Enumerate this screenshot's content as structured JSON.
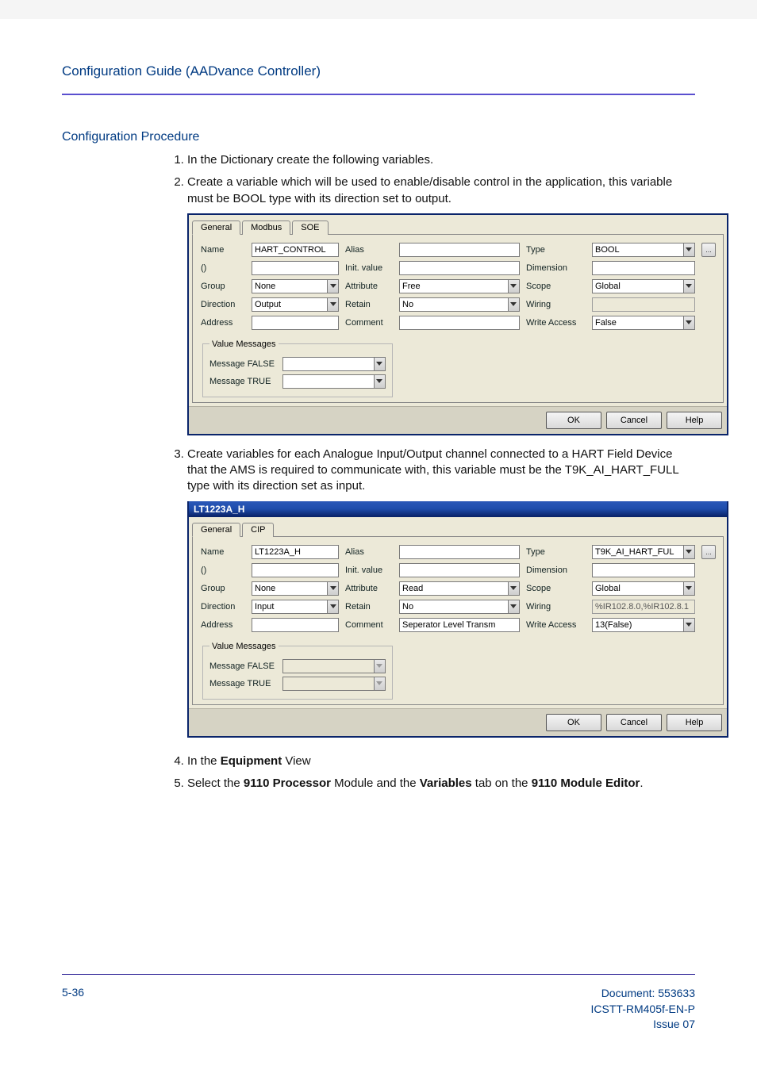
{
  "header": {
    "title": "Configuration Guide (AADvance Controller)"
  },
  "section": {
    "title": "Configuration Procedure"
  },
  "steps": {
    "s1": "In the Dictionary create the following variables.",
    "s2": "Create a variable which will be used to enable/disable control in the application, this variable must be BOOL type with its direction set to output.",
    "s3": "Create variables for each Analogue Input/Output channel connected to a HART Field Device that the AMS is required to communicate with, this variable must be the T9K_AI_HART_FULL type with its direction set as input.",
    "s4_prefix": "In the ",
    "s4_bold": "Equipment",
    "s4_suffix": " View",
    "s5_p1": "Select the ",
    "s5_b1": "9110 Processor",
    "s5_p2": " Module and the ",
    "s5_b2": "Variables",
    "s5_p3": " tab on the ",
    "s5_b3": "9110 Module Editor",
    "s5_p4": "."
  },
  "dlg1": {
    "tabs": {
      "general": "General",
      "modbus": "Modbus",
      "soe": "SOE"
    },
    "labels": {
      "name": "Name",
      "open": "()",
      "group": "Group",
      "direction": "Direction",
      "address": "Address",
      "alias": "Alias",
      "init": "Init. value",
      "attribute": "Attribute",
      "retain": "Retain",
      "comment": "Comment",
      "type": "Type",
      "dimension": "Dimension",
      "scope": "Scope",
      "wiring": "Wiring",
      "write": "Write Access"
    },
    "values": {
      "name": "HART_CONTROL",
      "open": "",
      "alias": "",
      "init": "",
      "type": "BOOL",
      "dimension": "",
      "group": "None",
      "attribute": "Free",
      "scope": "Global",
      "direction": "Output",
      "retain": "No",
      "wiring": "",
      "address": "",
      "comment": "",
      "write": "False"
    },
    "msgs": {
      "legend": "Value Messages",
      "false": "Message FALSE",
      "true": "Message TRUE"
    },
    "buttons": {
      "ok": "OK",
      "cancel": "Cancel",
      "help": "Help"
    },
    "ellipsis": "..."
  },
  "dlg2": {
    "title": "LT1223A_H",
    "tabs": {
      "general": "General",
      "cip": "CIP"
    },
    "labels": {
      "name": "Name",
      "open": "()",
      "group": "Group",
      "direction": "Direction",
      "address": "Address",
      "alias": "Alias",
      "init": "Init. value",
      "attribute": "Attribute",
      "retain": "Retain",
      "comment": "Comment",
      "type": "Type",
      "dimension": "Dimension",
      "scope": "Scope",
      "wiring": "Wiring",
      "write": "Write Access"
    },
    "values": {
      "name": "LT1223A_H",
      "open": "",
      "alias": "",
      "init": "",
      "type": "T9K_AI_HART_FUL",
      "dimension": "",
      "group": "None",
      "attribute": "Read",
      "scope": "Global",
      "direction": "Input",
      "retain": "No",
      "wiring": "%IR102.8.0,%IR102.8.1",
      "address": "",
      "comment": "Seperator Level Transm",
      "write": "13(False)"
    },
    "msgs": {
      "legend": "Value Messages",
      "false": "Message FALSE",
      "true": "Message TRUE"
    },
    "buttons": {
      "ok": "OK",
      "cancel": "Cancel",
      "help": "Help"
    },
    "ellipsis": "..."
  },
  "footer": {
    "page": "5-36",
    "doc_line1": "Document: 553633",
    "doc_line2": "ICSTT-RM405f-EN-P",
    "doc_line3": "Issue 07"
  }
}
